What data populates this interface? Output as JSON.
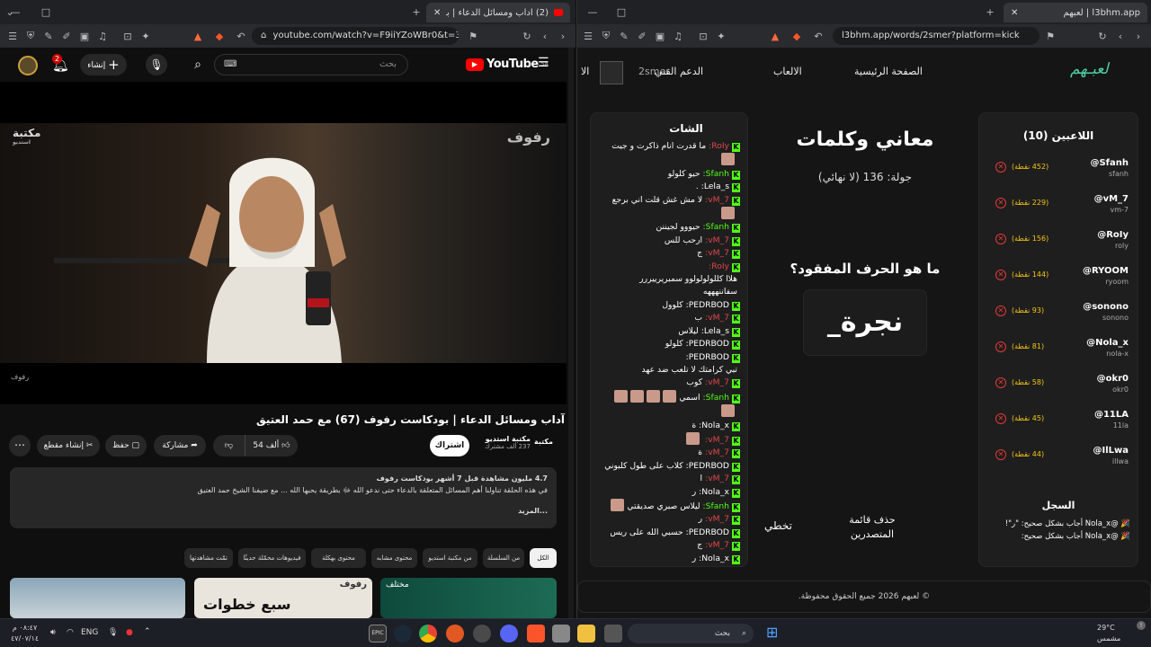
{
  "left_window": {
    "tab_title": "(2) آداب ومسائل الدعاء | بودكاست",
    "url": "youtube.com/watch?v=F9iiYZoWBr0&t=3...",
    "yt": {
      "logo": "YouTube",
      "logo_sup": "SA",
      "search_placeholder": "بحث",
      "create_label": "إنشاء",
      "notif_count": "2",
      "video_watermark": "رفوف",
      "video_brand": "مكتبة",
      "video_brand_sub": "استديو",
      "video_corner": "رفوف",
      "title": "آداب ومسائل الدعاء | بودكاست رفوف (67) مع حمد العتيق",
      "channel": "مكتبة استديو",
      "channel_subs": "237 ألف مشترك",
      "channel_logo": "مكتبة",
      "subscribe": "اشتراك",
      "likes": "54 ألف",
      "share": "مشاركة",
      "save": "حفظ",
      "clip": "إنشاء مقطع",
      "desc_stats": "4.7 مليون مشاهدة  قبل 7 أشهر  بودكاست رفوف",
      "desc_body": "في هذه الحلقة تناولنا أهم المسائل المتعلقة بالدعاء حتى ندعو الله ﷻ بطريقة يحبها الله ... مع ضيفنا الشيخ حمد العتيق",
      "desc_more": "...المزيد",
      "chips": [
        "الكل",
        "من السلسلة",
        "من مكتبة استديو",
        "محتوى مشابه",
        "محتوى بهكلة",
        "فيديوهات محمّلة حديثًا",
        "تمّت مشاهدتها"
      ],
      "thumb_text_1": "رفوف",
      "thumb_text_2": "سبع خطوات",
      "thumb_text_3": "مختلف"
    }
  },
  "right_window": {
    "tab_title": "لعبهم | l3bhm.app",
    "url": "l3bhm.app/words/2smer?platform=kick",
    "logo": "لعبـهم",
    "nav": [
      "الصفحة الرئيسية",
      "الالعاب",
      "الدعم الفني",
      "الا"
    ],
    "nav_user": "2smer",
    "players_title": "اللاعبين (10)",
    "players": [
      {
        "name": "@Sfanh",
        "handle": "sfanh",
        "points": "(452 نقطة)"
      },
      {
        "name": "@vM_7",
        "handle": "vm-7",
        "points": "(229 نقطة)"
      },
      {
        "name": "@RoIy",
        "handle": "roly",
        "points": "(156 نقطة)"
      },
      {
        "name": "@RYOOM",
        "handle": "ryoom",
        "points": "(144 نقطة)"
      },
      {
        "name": "@sonono",
        "handle": "sonono",
        "points": "(93 نقطة)"
      },
      {
        "name": "@Nola_x",
        "handle": "nola-x",
        "points": "(81 نقطة)"
      },
      {
        "name": "@okr0",
        "handle": "okr0",
        "points": "(58 نقطة)"
      },
      {
        "name": "@11LA",
        "handle": "11la",
        "points": "(45 نقطة)"
      },
      {
        "name": "@IlLwa",
        "handle": "illwa",
        "points": "(44 نقطة)"
      }
    ],
    "log_title": "السجل",
    "log": [
      "🎉 @Nola_x أجاب بشكل صحيح: \"ر\"!",
      "🎉 @Nola_x أجاب بشكل صحيح:"
    ],
    "game_title": "معاني وكلمات",
    "round": "جولة: 136 (لا نهائي)",
    "question": "ما هو الحرف المفقود؟",
    "word": "نجرة_",
    "btn_delete": "حذف قائمة المتصدرين",
    "btn_skip": "تخطي",
    "chat_title": "الشات",
    "chat": [
      {
        "user": "RoIy:",
        "msg": "ما قدرت انام ذاكرت و جيت"
      },
      {
        "user": "",
        "msg": "",
        "emote": true
      },
      {
        "user": "Sfanh:",
        "msg": "حيو كلولو"
      },
      {
        "user": "Lela_s:",
        "msg": "."
      },
      {
        "user": "vM_7:",
        "msg": "لا مش غش قلت اني برجع"
      },
      {
        "user": "",
        "msg": "",
        "emote": true
      },
      {
        "user": "Sfanh:",
        "msg": "حيووو لجيننن"
      },
      {
        "user": "vM_7:",
        "msg": "ارحب للس"
      },
      {
        "user": "vM_7:",
        "msg": "ج"
      },
      {
        "user": "RoIy:",
        "msg": ""
      },
      {
        "user": "",
        "msg": "هلاا كللولولولوو سمبريرييررر"
      },
      {
        "user": "",
        "msg": "سفاننهههه"
      },
      {
        "user": "PEDRBOD:",
        "msg": "كلوول"
      },
      {
        "user": "vM_7:",
        "msg": "ب"
      },
      {
        "user": "Lela_s:",
        "msg": "ليلاس"
      },
      {
        "user": "PEDRBOD:",
        "msg": "كلولو"
      },
      {
        "user": "PEDRBOD:",
        "msg": ""
      },
      {
        "user": "",
        "msg": "تبي كرامتك لا تلعب ضد عهد"
      },
      {
        "user": "vM_7:",
        "msg": "كوب"
      },
      {
        "user": "Sfanh:",
        "msg": "اسمي",
        "emotes": 4
      },
      {
        "user": "",
        "msg": "",
        "emote": true
      },
      {
        "user": "Nola_x:",
        "msg": "ة"
      },
      {
        "user": "vM_7:",
        "msg": "",
        "emote": true
      },
      {
        "user": "vM_7:",
        "msg": "ة"
      },
      {
        "user": "PEDRBOD:",
        "msg": "كلاب على طول كلبوني"
      },
      {
        "user": "vM_7:",
        "msg": "ا"
      },
      {
        "user": "Nola_x:",
        "msg": "ر"
      },
      {
        "user": "Sfanh:",
        "msg": "ليلاس صبري صديقتي",
        "emotes": 1
      },
      {
        "user": "vM_7:",
        "msg": "ر"
      },
      {
        "user": "PEDRBOD:",
        "msg": "حسبي الله على ريس"
      },
      {
        "user": "vM_7:",
        "msg": "ج"
      },
      {
        "user": "Nola_x:",
        "msg": "ر"
      }
    ],
    "footer": "© لعبهم 2026 جميع الحقوق محفوظة."
  },
  "taskbar": {
    "time": "٠٨:٤٧ م",
    "date": "٤٧/٠٧/١٤",
    "lang": "ENG",
    "search": "بحث",
    "weather_temp": "29°C",
    "weather_desc": "مشمس"
  },
  "colors": {
    "kick_green": "#53fc18",
    "youtube_red": "#ff0000",
    "l3bhm_logo": "#4fd1a5",
    "remove_red": "#e53935"
  }
}
